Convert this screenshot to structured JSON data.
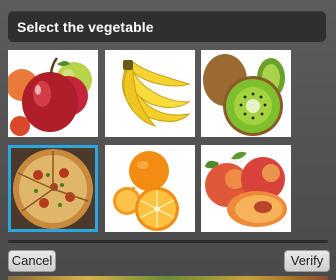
{
  "dialog": {
    "title": "Select the vegetable",
    "tiles": [
      {
        "name": "apples",
        "selected": false
      },
      {
        "name": "bananas",
        "selected": false
      },
      {
        "name": "kiwi",
        "selected": false
      },
      {
        "name": "pizza",
        "selected": true
      },
      {
        "name": "orange",
        "selected": false
      },
      {
        "name": "peaches",
        "selected": false
      }
    ],
    "cancel_label": "Cancel",
    "verify_label": "Verify"
  },
  "colors": {
    "header_bg": "#2f2f2f",
    "selection": "#2aa7e0",
    "dialog_bg": "#4f4f4f"
  }
}
